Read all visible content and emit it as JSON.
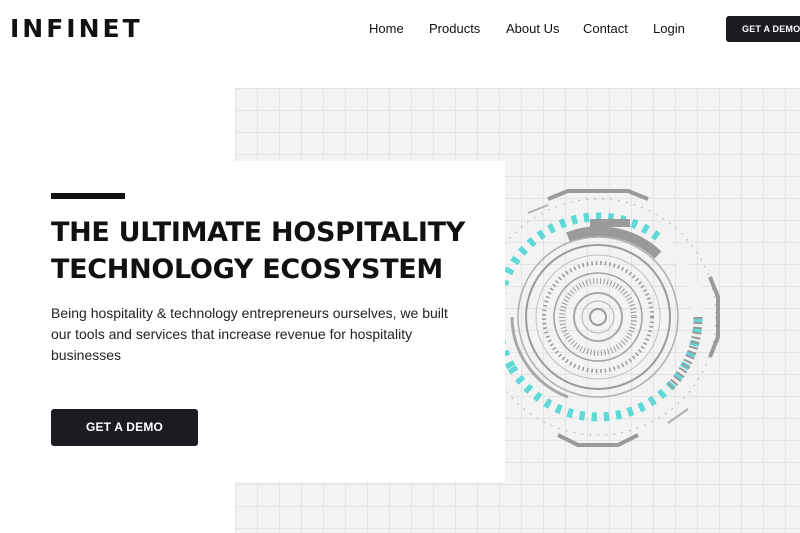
{
  "brand": {
    "logo_text": "INFINET"
  },
  "nav": {
    "items": [
      {
        "label": "Home"
      },
      {
        "label": "Products"
      },
      {
        "label": "About Us"
      },
      {
        "label": "Contact"
      },
      {
        "label": "Login"
      }
    ],
    "cta_label": "GET A DEMO"
  },
  "hero": {
    "title_line1": "THE ULTIMATE HOSPITALITY",
    "title_line2": "TECHNOLOGY ECOSYSTEM",
    "description": "Being hospitality & technology entrepreneurs ourselves, we built our tools and services that increase revenue for hospitality businesses",
    "cta_label": "GET A DEMO"
  },
  "colors": {
    "dark": "#1b1c22",
    "accent_cyan": "#5fd8d8",
    "hud_gray": "#9a9a9a",
    "grid_bg": "#f3f3f3"
  },
  "icons": {
    "hero_graphic": "circular-hud-graphic"
  }
}
